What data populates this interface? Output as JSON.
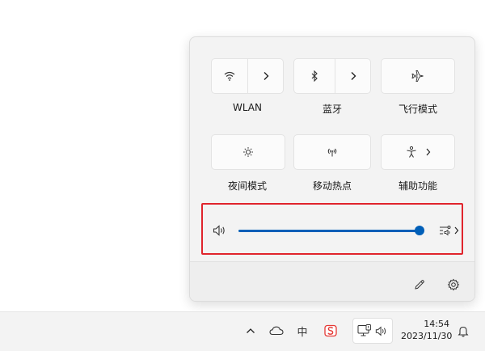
{
  "quick_settings": {
    "tiles": [
      {
        "label": "WLAN",
        "icon": "wifi-icon",
        "has_arrow": true
      },
      {
        "label": "蓝牙",
        "icon": "bluetooth-icon",
        "has_arrow": true
      },
      {
        "label": "飞行模式",
        "icon": "airplane-icon",
        "has_arrow": false
      },
      {
        "label": "夜间模式",
        "icon": "night-light-icon",
        "has_arrow": false
      },
      {
        "label": "移动热点",
        "icon": "hotspot-icon",
        "has_arrow": false
      },
      {
        "label": "辅助功能",
        "icon": "accessibility-icon",
        "has_arrow": true
      }
    ],
    "volume": {
      "icon": "speaker-icon",
      "level_fraction": 1.0,
      "output_icon": "audio-output-icon",
      "highlight_color": "#e0242c"
    },
    "footer": {
      "edit_icon": "pencil-icon",
      "settings_icon": "gear-icon"
    }
  },
  "taskbar": {
    "tray": [
      {
        "name": "show-hidden-icons-chevron",
        "icon": "chevron-up-icon"
      },
      {
        "name": "onedrive",
        "icon": "cloud-icon"
      },
      {
        "name": "ime-indicator",
        "text": "中"
      },
      {
        "name": "app-tray",
        "icon": "sogou-s-icon"
      }
    ],
    "clock": {
      "time": "14:54",
      "date": "2023/11/30"
    },
    "accent": "#005fb8"
  }
}
